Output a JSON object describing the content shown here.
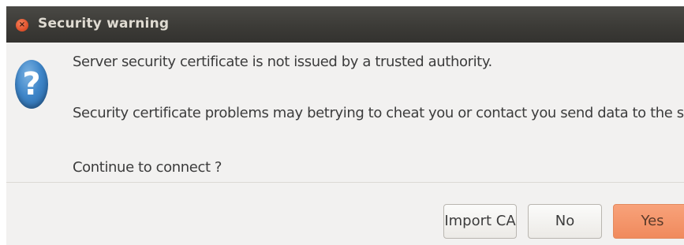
{
  "dialog": {
    "title": "Security warning",
    "close_glyph": "×",
    "icon": "question-icon",
    "icon_glyph": "?",
    "messages": [
      "Server security certificate is not issued by a trusted authority.",
      "Security certificate problems may betrying to cheat you or contact you send data to the server",
      "Continue to connect ?"
    ],
    "buttons": {
      "import_ca": "Import CA",
      "no": "No",
      "yes": "Yes"
    }
  },
  "colors": {
    "titlebar": "#3c3b37",
    "title_text": "#dfdbd2",
    "close_button": "#e1532d",
    "window_background": "#f2f1f0",
    "default_button": "#f08a5d",
    "question_icon": "#3f86c9"
  }
}
